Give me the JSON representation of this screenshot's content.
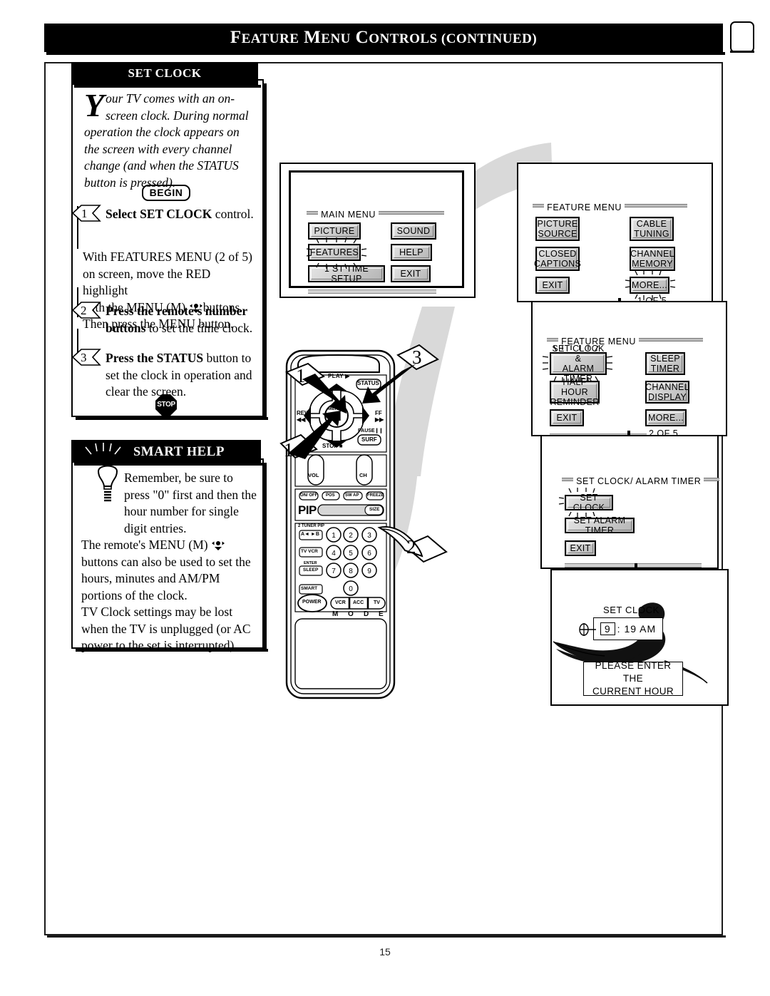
{
  "header": {
    "title_parts": [
      "F",
      "EATURE",
      " M",
      "ENU",
      " C",
      "ONTROLS (",
      "CONTINUED",
      ")"
    ],
    "title": "Feature Menu Controls (continued)",
    "tv_icon": "tv-icon"
  },
  "page_number": "15",
  "set_clock_panel": {
    "tab_label": "SET CLOCK",
    "dropcap": "Y",
    "intro": "our TV comes with an on-screen clock. During normal operation the clock appears on the screen with every channel change (and when the STATUS button is pressed).",
    "begin_label": "BEGIN",
    "steps": [
      {
        "num": "1",
        "bold": "Select SET CLOCK",
        "rest": " control."
      },
      {
        "num": "2",
        "bold": "Press the remote's number buttons",
        "rest": " to set the time clock."
      },
      {
        "num": "3",
        "bold": "Press the STATUS",
        "rest": " button to set the clock in operation and clear the screen."
      }
    ],
    "step1_paragraph": "With FEATURES MENU (2 of 5) on screen, move the RED highlight with the MENU (M)  buttons. Then press the MENU button.",
    "step1_para_a": "With FEATURES MENU (2 of 5)",
    "step1_para_b": "on screen, move the RED highlight",
    "step1_para_c": "with the MENU (M)",
    "step1_para_d": "buttons.",
    "step1_para_e": "Then press the MENU button.",
    "stop_label": "STOP"
  },
  "smart_help_panel": {
    "tab_label": "Smart Help",
    "tab_parts": [
      "S",
      "MART",
      " H",
      "ELP"
    ],
    "bulb_icon": "lightbulb-icon",
    "paragraph_1": "Remember, be sure to press \"0\" first and then the hour number for single digit entries.",
    "paragraph_2_a": "The remote's MENU (M)",
    "paragraph_2_b": "buttons can also be used to set the hours, minutes and AM/PM portions of the clock.",
    "paragraph_3": "TV Clock settings may be lost when the TV is unplugged (or AC power to the set is interrupted)."
  },
  "screens": {
    "main_menu": {
      "title": "MAIN MENU",
      "buttons": [
        {
          "label": "PICTURE",
          "highlighted": false
        },
        {
          "label": "SOUND",
          "highlighted": false
        },
        {
          "label": "FEATURES",
          "highlighted": true
        },
        {
          "label": "HELP",
          "highlighted": false
        },
        {
          "label": "1 ST TIME SETUP",
          "highlighted": false
        },
        {
          "label": "EXIT",
          "highlighted": false
        }
      ]
    },
    "feature_menu_1": {
      "title": "FEATURE MENU",
      "page_indicator": "1 OF 5",
      "buttons": [
        {
          "label": "PICTURE SOURCE",
          "line1": "PICTURE",
          "line2": "SOURCE",
          "highlighted": false
        },
        {
          "label": "CABLE TUNING",
          "line1": "CABLE",
          "line2": "TUNING",
          "highlighted": false
        },
        {
          "label": "CLOSED CAPTIONS",
          "line1": "CLOSED",
          "line2": "CAPTIONS",
          "highlighted": false
        },
        {
          "label": "CHANNEL MEMORY",
          "line1": "CHANNEL",
          "line2": "MEMORY",
          "highlighted": false
        },
        {
          "label": "EXIT",
          "line1": "EXIT",
          "line2": "",
          "highlighted": false
        },
        {
          "label": "MORE...",
          "line1": "MORE...",
          "line2": "",
          "highlighted": true
        }
      ]
    },
    "feature_menu_2": {
      "title": "FEATURE MENU",
      "page_indicator": "2 OF 5",
      "buttons": [
        {
          "label": "SET CLOCK & ALARM TIMER",
          "line1": "SET CLOCK &",
          "line2": "ALARM TIMER",
          "highlighted": true
        },
        {
          "label": "SLEEP TIMER",
          "line1": "SLEEP",
          "line2": "TIMER",
          "highlighted": false
        },
        {
          "label": "HALF HOUR REMINDER",
          "line1": "HALF HOUR",
          "line2": "REMINDER",
          "highlighted": false
        },
        {
          "label": "CHANNEL DISPLAY",
          "line1": "CHANNEL",
          "line2": "DISPLAY",
          "highlighted": false
        },
        {
          "label": "EXIT",
          "line1": "EXIT",
          "line2": "",
          "highlighted": false
        },
        {
          "label": "MORE...",
          "line1": "MORE...",
          "line2": "",
          "highlighted": false
        }
      ]
    },
    "set_clock_alarm": {
      "title": "SET CLOCK/ ALARM TIMER",
      "buttons": [
        {
          "label": "SET CLOCK",
          "highlighted": true
        },
        {
          "label": "SET ALARM TIMER",
          "highlighted": false
        },
        {
          "label": "EXIT",
          "highlighted": false
        }
      ]
    },
    "clock_entry": {
      "title": "SET CLOCK",
      "hour": "9",
      "separator": ":",
      "minutes_ampm": "19 AM",
      "time_display": "9 : 19 AM",
      "message_line1": "PLEASE ENTER THE",
      "message_line2": "CURRENT HOUR"
    }
  },
  "remote": {
    "callouts": [
      "1",
      "1",
      "2",
      "3"
    ],
    "labels": {
      "play": "PLAY",
      "rew": "REW",
      "ff": "FF",
      "stop": "STOP",
      "pause": "PAUSE",
      "surf": "SURF",
      "status": "STATUS",
      "menu": "MENU",
      "menu_center": "M",
      "vol": "VOL",
      "ch": "CH",
      "pip_row": [
        "ON/ OFF",
        "POS",
        "SW AP",
        "FREEZE"
      ],
      "pip": "PIP",
      "size": "SIZE",
      "tuner_pip": "2 TUNER PIP",
      "ab_swap": "A◄ ►B",
      "tv_vcr": "TV VCR",
      "enter": "ENTER",
      "sleep": "SLEEP",
      "smart": "SMART",
      "power": "POWER",
      "mode_buttons": [
        "VCR",
        "ACC",
        "TV"
      ],
      "mode": [
        "M",
        "O",
        "D",
        "E"
      ],
      "keypad": [
        "1",
        "2",
        "3",
        "4",
        "5",
        "6",
        "7",
        "8",
        "9",
        "0"
      ]
    }
  },
  "colors": {
    "ink": "#000000",
    "paper": "#ffffff",
    "swoosh": "#d9d9d9",
    "osd_button": "#cfcfcf"
  }
}
